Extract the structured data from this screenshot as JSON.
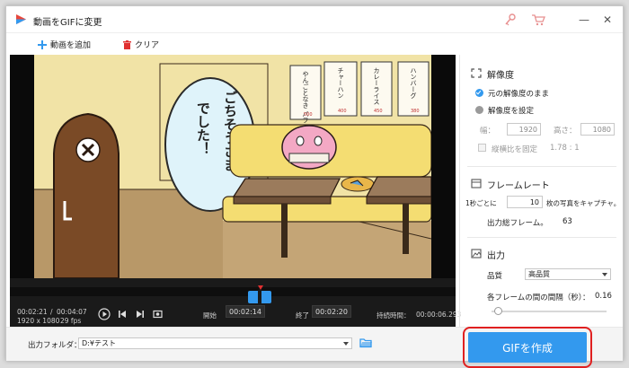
{
  "window": {
    "title": "動画をGIFに変更"
  },
  "toolbar": {
    "add_video": "動画を追加",
    "clear": "クリア"
  },
  "scene": {
    "speech": [
      "ごちそうさま",
      "でした！"
    ],
    "menu": [
      {
        "text": "やんごとなき パフェ",
        "price": "500"
      },
      {
        "text": "チャーハン",
        "price": "400"
      },
      {
        "text": "カレーライス",
        "price": "450"
      },
      {
        "text": "ハンバーグ",
        "price": "380"
      }
    ]
  },
  "player": {
    "current_time": "00:02:21",
    "sep": "/",
    "total_time": "00:04:07",
    "resolution": "1920 x 1080",
    "fps": "29 fps",
    "start_label": "開始",
    "start_value": "00:02:14",
    "end_label": "終了",
    "end_value": "00:02:20",
    "duration_label": "持続時間：",
    "duration_value": "00:00:06.293"
  },
  "side": {
    "resolution_title": "解像度",
    "keep_original": "元の解像度のまま",
    "set_resolution": "解像度を設定",
    "width_label": "幅：",
    "width_value": "1920",
    "height_label": "高さ：",
    "height_value": "1080",
    "fix_ratio": "縦横比を固定",
    "ratio_value": "1.78 : 1",
    "framerate_title": "フレームレート",
    "per_sec_prefix": "1秒ごとに",
    "per_sec_value": "10",
    "per_sec_suffix": "枚の写真をキャプチャ。",
    "total_frames_label": "出力総フレーム。",
    "total_frames_value": "63",
    "output_title": "出力",
    "quality_label": "品質",
    "quality_value": "高品質",
    "interval_label": "各フレームの間の間隔（秒）：",
    "interval_value": "0.16",
    "interval_fraction": 0.02
  },
  "bottom": {
    "folder_label": "出力フォルダ：",
    "folder_value": "D:¥テスト",
    "create_gif": "GIFを作成"
  },
  "colors": {
    "accent": "#3399ee",
    "highlight": "#e02020",
    "delete_red": "#e03030"
  }
}
